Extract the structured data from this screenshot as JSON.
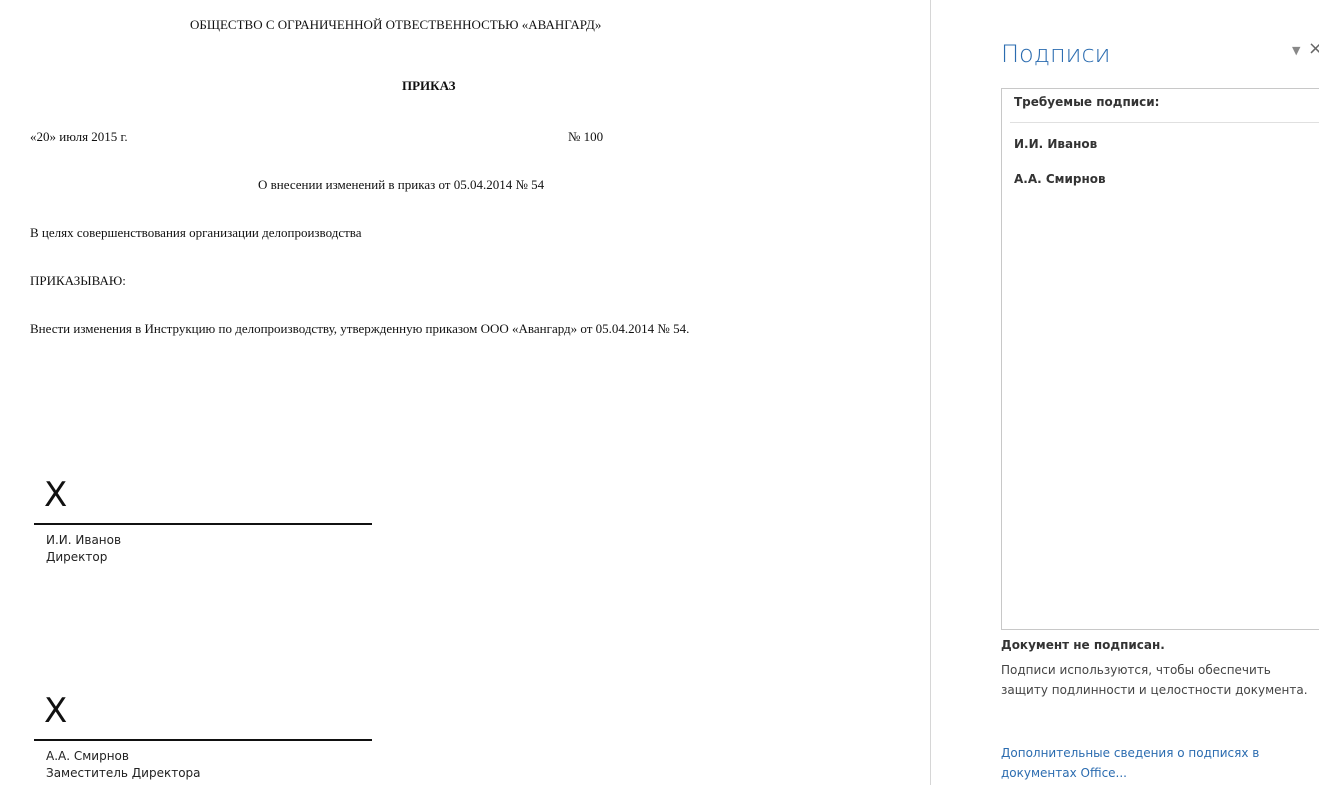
{
  "document": {
    "org_header": "ОБЩЕСТВО С ОГРАНИЧЕННОЙ ОТВЕСТВЕННОСТЬЮ «АВАНГАРД»",
    "title": "ПРИКАЗ",
    "date": "«20» июля 2015 г.",
    "number": "№ 100",
    "subject": "О внесении изменений в приказ от 05.04.2014 № 54",
    "purpose": "В целях совершенствования организации делопроизводства",
    "order_word": "ПРИКАЗЫВАЮ:",
    "body": "Внести изменения в Инструкцию по делопроизводству, утвержденную приказом ООО «Авангард» от 05.04.2014 № 54.",
    "signatures": [
      {
        "mark": "X",
        "name": "И.И. Иванов",
        "position": "Директор"
      },
      {
        "mark": "X",
        "name": "А.А. Смирнов",
        "position": "Заместитель Директора"
      }
    ]
  },
  "pane": {
    "title": "Подписи",
    "dropdown_icon": "triangle-down-icon",
    "close_icon": "close-icon",
    "required_label": "Требуемые подписи:",
    "required": [
      "И.И. Иванов",
      "А.А. Смирнов"
    ],
    "status": "Документ не подписан.",
    "description": "Подписи используются, чтобы обеспечить защиту подлинности и целостности документа.",
    "link": "Дополнительные сведения о подписях в документах Office..."
  },
  "colors": {
    "accent": "#2b6cb0",
    "text": "#111111",
    "border": "#c8c8c8"
  }
}
